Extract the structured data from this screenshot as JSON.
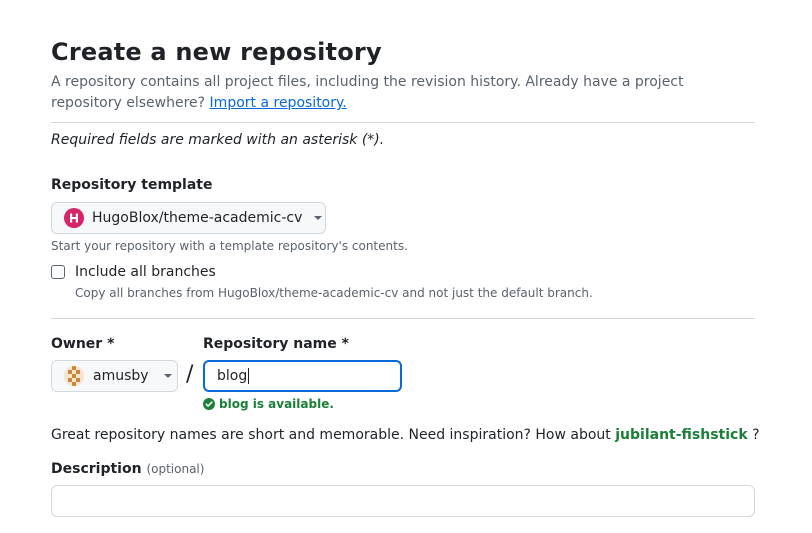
{
  "page": {
    "title": "Create a new repository",
    "intro_text": "A repository contains all project files, including the revision history. Already have a project repository elsewhere?",
    "import_link": "Import a repository.",
    "required_note": "Required fields are marked with an asterisk (*)."
  },
  "template": {
    "label": "Repository template",
    "selected": "HugoBlox/theme-academic-cv",
    "hint": "Start your repository with a template repository's contents.",
    "include_branches_label": "Include all branches",
    "include_branches_checked": false,
    "include_branches_hint": "Copy all branches from HugoBlox/theme-academic-cv and not just the default branch."
  },
  "owner": {
    "label": "Owner *",
    "selected": "amusby"
  },
  "separator": "/",
  "repo_name": {
    "label": "Repository name *",
    "value": "blog",
    "availability": "blog is available."
  },
  "suggestion": {
    "prefix": "Great repository names are short and memorable. Need inspiration? How about",
    "name": "jubilant-fishstick",
    "suffix": "?"
  },
  "description": {
    "label": "Description",
    "optional": "(optional)",
    "value": ""
  },
  "colors": {
    "accent_link": "#0969da",
    "success": "#1a7f37",
    "focus_border": "#0969da",
    "template_avatar": "#d6236a"
  },
  "icons": {
    "template_avatar": "hugoblox-logo-icon",
    "owner_avatar": "identicon-avatar-icon",
    "availability": "check-circle-fill-icon",
    "dropdown": "triangle-down-icon"
  }
}
